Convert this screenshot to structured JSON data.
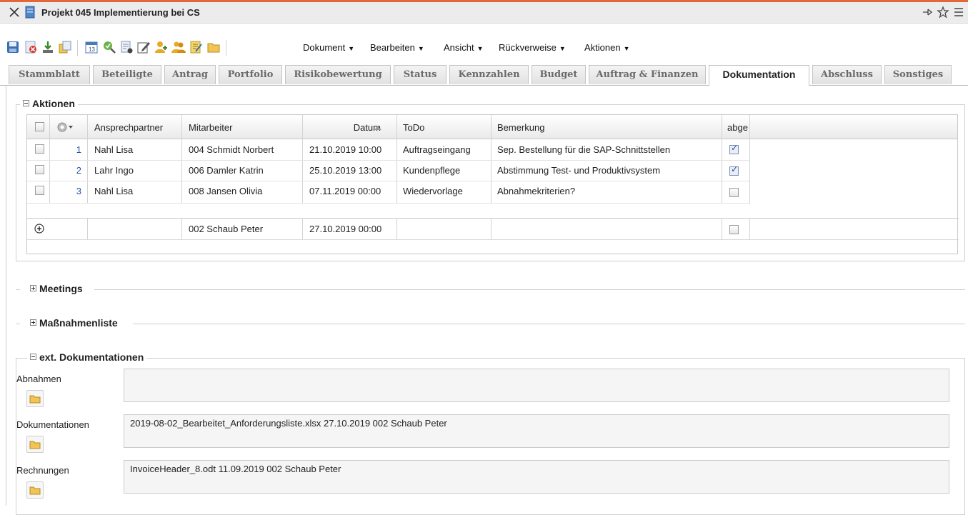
{
  "window": {
    "title": "Projekt 045 Implementierung bei CS"
  },
  "toolbar": {
    "icons": [
      "save-icon",
      "delete-icon",
      "download-icon",
      "copy-icon",
      "calendar-icon",
      "search-check-icon",
      "report-icon",
      "edit-icon",
      "user-add-icon",
      "user-group-icon",
      "notes-icon",
      "folder-icon"
    ],
    "menus": [
      {
        "label": "Dokument"
      },
      {
        "label": "Bearbeiten"
      },
      {
        "label": "Ansicht"
      },
      {
        "label": "Rückverweise"
      },
      {
        "label": "Aktionen"
      }
    ]
  },
  "tabs": [
    {
      "label": "Stammblatt"
    },
    {
      "label": "Beteiligte"
    },
    {
      "label": "Antrag"
    },
    {
      "label": "Portfolio"
    },
    {
      "label": "Risikobewertung"
    },
    {
      "label": "Status"
    },
    {
      "label": "Kennzahlen"
    },
    {
      "label": "Budget"
    },
    {
      "label": "Auftrag & Finanzen"
    },
    {
      "label": "Dokumentation"
    },
    {
      "label": "Abschluss"
    },
    {
      "label": "Sonstiges"
    }
  ],
  "active_tab": "Dokumentation",
  "actions": {
    "legend": "Aktionen",
    "columns": {
      "ansprechpartner": "Ansprechpartner",
      "mitarbeiter": "Mitarbeiter",
      "datum": "Datum",
      "todo": "ToDo",
      "bemerkung": "Bemerkung",
      "abge": "abge"
    },
    "rows": [
      {
        "nr": "1",
        "ansprechpartner": "Nahl Lisa",
        "mitarbeiter": "004 Schmidt Norbert",
        "datum": "21.10.2019 10:00",
        "todo": "Auftragseingang",
        "bemerkung": "Sep. Bestellung für die SAP-Schnittstellen",
        "abge": true
      },
      {
        "nr": "2",
        "ansprechpartner": "Lahr Ingo",
        "mitarbeiter": "006 Damler Katrin",
        "datum": "25.10.2019 13:00",
        "todo": "Kundenpflege",
        "bemerkung": "Abstimmung Test- und Produktivsystem",
        "abge": true
      },
      {
        "nr": "3",
        "ansprechpartner": "Nahl Lisa",
        "mitarbeiter": "008 Jansen Olivia",
        "datum": "07.11.2019 00:00",
        "todo": "Wiedervorlage",
        "bemerkung": "Abnahmekriterien?",
        "abge": false
      }
    ],
    "new_row": {
      "ansprechpartner": "",
      "mitarbeiter": "002 Schaub Peter",
      "datum": "27.10.2019 00:00",
      "todo": "",
      "bemerkung": "",
      "abge": false
    }
  },
  "sections": {
    "meetings": "Meetings",
    "massnahmen": "Maßnahmenliste",
    "ext_docs": "ext. Dokumentationen"
  },
  "ext_docs": {
    "abnahmen": {
      "label": "Abnahmen",
      "value": ""
    },
    "dokumentationen": {
      "label": "Dokumentationen",
      "value": "2019-08-02_Bearbeitet_Anforderungsliste.xlsx 27.10.2019 002 Schaub Peter"
    },
    "rechnungen": {
      "label": "Rechnungen",
      "value": "InvoiceHeader_8.odt 11.09.2019 002 Schaub Peter"
    }
  }
}
